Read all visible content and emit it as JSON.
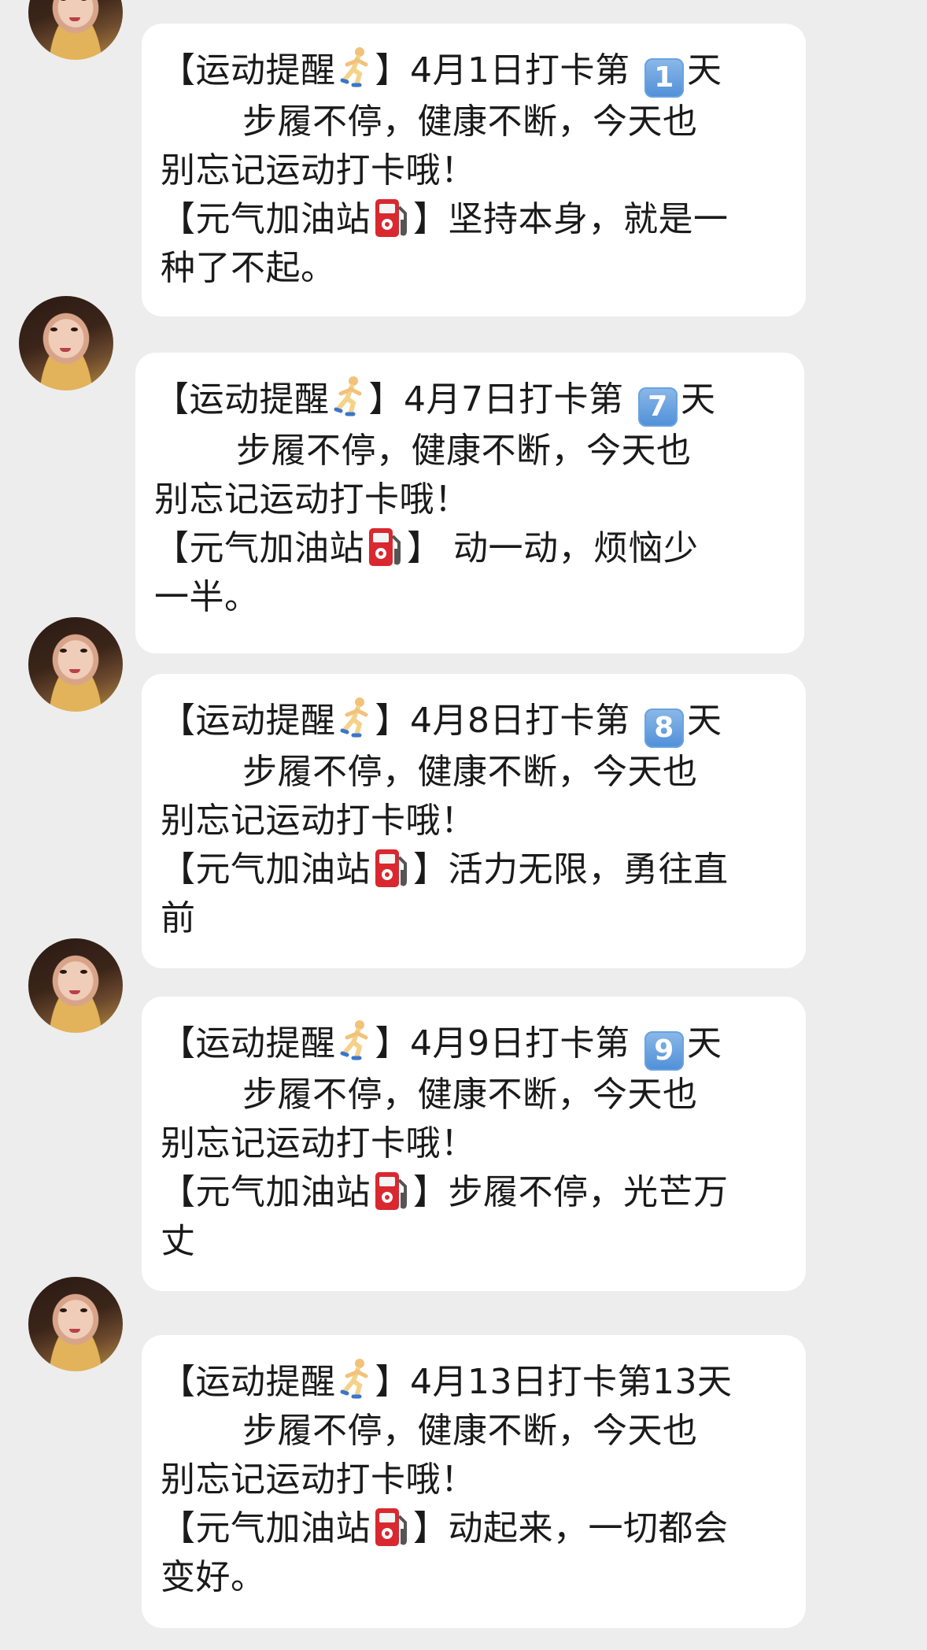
{
  "messages": [
    {
      "line1": [
        "【运动提醒",
        "】4月1日打卡第 ",
        "1",
        "天"
      ],
      "line2": "步履不停，健康不断，今天也",
      "line3": "别忘记运动打卡哦！",
      "line4": [
        "【元气加油站",
        "】坚持本身，就是一"
      ],
      "line5": "种了不起。"
    },
    {
      "line1": [
        "【运动提醒",
        "】4月7日打卡第 ",
        "7",
        "天"
      ],
      "line2": "步履不停，健康不断，今天也",
      "line3": "别忘记运动打卡哦！",
      "line4": [
        "【元气加油站",
        "】 动一动，烦恼少"
      ],
      "line5": "一半。"
    },
    {
      "line1": [
        "【运动提醒",
        "】4月8日打卡第 ",
        "8",
        "天"
      ],
      "line2": "步履不停，健康不断，今天也",
      "line3": "别忘记运动打卡哦！",
      "line4": [
        "【元气加油站",
        "】活力无限，勇往直"
      ],
      "line5": "前"
    },
    {
      "line1": [
        "【运动提醒",
        "】4月9日打卡第 ",
        "9",
        "天"
      ],
      "line2": "步履不停，健康不断，今天也",
      "line3": "别忘记运动打卡哦！",
      "line4": [
        "【元气加油站",
        "】步履不停，光芒万"
      ],
      "line5": "丈"
    },
    {
      "line1": [
        "【运动提醒",
        "】4月13日打卡第13天"
      ],
      "line2": "步履不停，健康不断，今天也",
      "line3": "别忘记运动打卡哦！",
      "line4": [
        "【元气加油站",
        "】动起来，一切都会"
      ],
      "line5": "变好。"
    }
  ],
  "icons": {
    "runner": "running-person-emoji",
    "pump": "fuel-pump-emoji",
    "keycap": "keycap-digit-emoji"
  },
  "colors": {
    "background": "#ededed",
    "bubble": "#ffffff",
    "text": "#1a1a1a",
    "keycap": "#4f8fd8",
    "pump": "#d9282f"
  }
}
